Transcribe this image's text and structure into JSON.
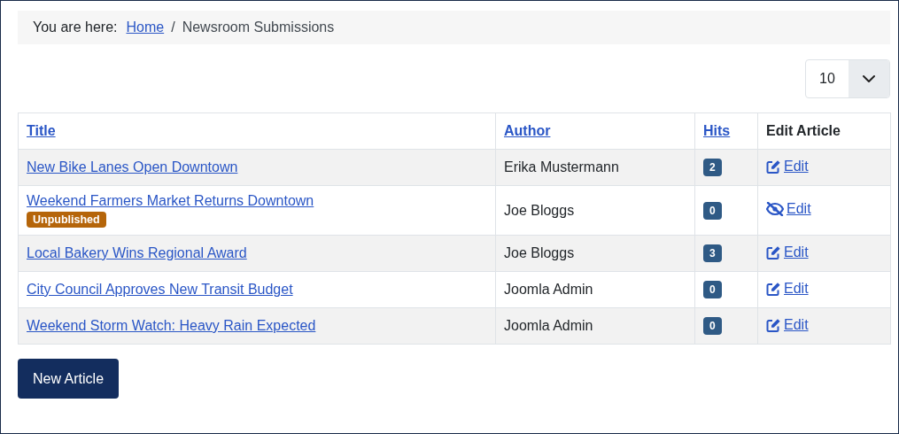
{
  "breadcrumb": {
    "label": "You are here:",
    "items": [
      {
        "text": "Home",
        "link": true
      },
      {
        "text": "Newsroom Submissions",
        "link": false
      }
    ],
    "separator": "/"
  },
  "limit": {
    "value": "10"
  },
  "table": {
    "columns": [
      {
        "label": "Title",
        "sortable": true
      },
      {
        "label": "Author",
        "sortable": true
      },
      {
        "label": "Hits",
        "sortable": true
      },
      {
        "label": "Edit Article",
        "sortable": false
      }
    ],
    "rows": [
      {
        "title": "New Bike Lanes Open Downtown",
        "published": true,
        "author": "Erika Mustermann",
        "hits": "2",
        "edit": "Edit"
      },
      {
        "title": "Weekend Farmers Market Returns Downtown",
        "published": false,
        "badge": "Unpublished",
        "author": "Joe Bloggs",
        "hits": "0",
        "edit": "Edit"
      },
      {
        "title": "Local Bakery Wins Regional Award",
        "published": true,
        "author": "Joe Bloggs",
        "hits": "3",
        "edit": "Edit"
      },
      {
        "title": "City Council Approves New Transit Budget",
        "published": true,
        "author": "Joomla Admin",
        "hits": "0",
        "edit": "Edit"
      },
      {
        "title": "Weekend Storm Watch: Heavy Rain Expected",
        "published": true,
        "author": "Joomla Admin",
        "hits": "0",
        "edit": "Edit"
      }
    ]
  },
  "new_button": "New Article"
}
